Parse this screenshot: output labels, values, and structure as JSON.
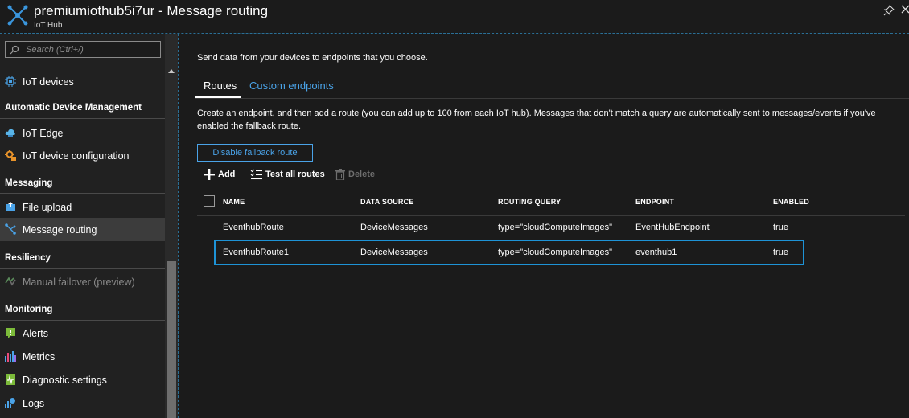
{
  "window": {
    "title": "premiumiothub5i7ur - Message routing",
    "subtitle": "IoT Hub"
  },
  "sidebar": {
    "search_placeholder": "Search (Ctrl+/)",
    "collapse_glyph": "«",
    "items": [
      {
        "label": "IoT devices",
        "icon": "chip-icon"
      },
      {
        "section": "Automatic Device Management"
      },
      {
        "label": "IoT Edge",
        "icon": "cloud-icon"
      },
      {
        "label": "IoT device configuration",
        "icon": "gear-icon"
      },
      {
        "section": "Messaging"
      },
      {
        "label": "File upload",
        "icon": "file-upload-icon"
      },
      {
        "label": "Message routing",
        "icon": "routing-icon",
        "selected": true
      },
      {
        "section": "Resiliency"
      },
      {
        "label": "Manual failover (preview)",
        "icon": "failover-icon",
        "disabled": true
      },
      {
        "section": "Monitoring"
      },
      {
        "label": "Alerts",
        "icon": "alert-icon"
      },
      {
        "label": "Metrics",
        "icon": "metrics-icon"
      },
      {
        "label": "Diagnostic settings",
        "icon": "diagnostic-icon"
      },
      {
        "label": "Logs",
        "icon": "logs-icon"
      }
    ]
  },
  "main": {
    "intro": "Send data from your devices to endpoints that you choose.",
    "tabs": [
      {
        "label": "Routes",
        "active": true
      },
      {
        "label": "Custom endpoints",
        "active": false
      }
    ],
    "description": "Create an endpoint, and then add a route (you can add up to 100 from each IoT hub). Messages that don't match a query are automatically sent to messages/events if you've enabled the fallback route.",
    "fallback_button": "Disable fallback route",
    "toolbar": {
      "add": "Add",
      "test": "Test all routes",
      "delete": "Delete"
    },
    "table": {
      "headers": [
        "NAME",
        "DATA SOURCE",
        "ROUTING QUERY",
        "ENDPOINT",
        "ENABLED"
      ],
      "rows": [
        [
          "EventhubRoute",
          "DeviceMessages",
          "type=\"cloudComputeImages\"",
          "EventHubEndpoint",
          "true"
        ],
        [
          "EventhubRoute1",
          "DeviceMessages",
          "type=\"cloudComputeImages\"",
          "eventhub1",
          "true"
        ]
      ],
      "highlighted_row": 1
    }
  },
  "colors": {
    "background": "#1b1b1b",
    "sidebar": "#212121",
    "accent": "#4aa3e8",
    "highlight_border": "#1e93d6",
    "selected_item": "#3c3c3c"
  }
}
